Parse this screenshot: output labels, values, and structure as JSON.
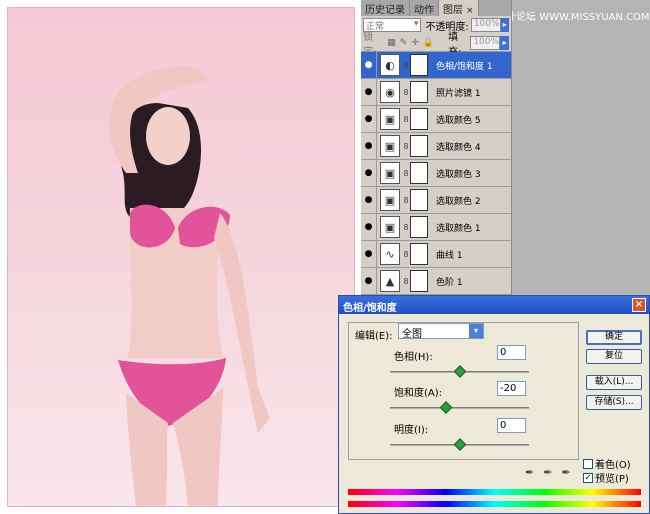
{
  "watermark": "思缘设计论坛 WWW.MISSYUAN.COM",
  "panel": {
    "tabs": [
      {
        "label": "历史记录",
        "active": false
      },
      {
        "label": "动作",
        "active": false
      },
      {
        "label": "图层",
        "active": true
      }
    ],
    "close": "×",
    "blend_mode": "正常",
    "opacity_label": "不透明度:",
    "opacity_value": "100%",
    "lock_label": "锁定:",
    "fill_label": "填充:",
    "fill_value": "100%",
    "layers": [
      {
        "name": "色相/饱和度 1",
        "selected": true,
        "thumb": "hue-icon"
      },
      {
        "name": "照片滤镜 1",
        "selected": false,
        "thumb": "filter-icon"
      },
      {
        "name": "选取颜色 5",
        "selected": false,
        "thumb": "selective-color-icon"
      },
      {
        "name": "选取颜色 4",
        "selected": false,
        "thumb": "selective-color-icon"
      },
      {
        "name": "选取颜色 3",
        "selected": false,
        "thumb": "selective-color-icon"
      },
      {
        "name": "选取颜色 2",
        "selected": false,
        "thumb": "selective-color-icon"
      },
      {
        "name": "选取颜色 1",
        "selected": false,
        "thumb": "selective-color-icon"
      },
      {
        "name": "曲线 1",
        "selected": false,
        "thumb": "curves-icon"
      },
      {
        "name": "色阶 1",
        "selected": false,
        "thumb": "levels-icon"
      }
    ]
  },
  "dialog": {
    "title": "色相/饱和度",
    "close": "×",
    "edit_label": "编辑(E):",
    "edit_value": "全图",
    "params": [
      {
        "label": "色相(H):",
        "value": "0"
      },
      {
        "label": "饱和度(A):",
        "value": "-20"
      },
      {
        "label": "明度(I):",
        "value": "0"
      }
    ],
    "buttons": {
      "ok": "确定",
      "reset": "复位",
      "load": "载入(L)...",
      "save": "存储(S)..."
    },
    "colorize_label": "着色(O)",
    "colorize_checked": false,
    "preview_label": "预览(P)",
    "preview_checked": true
  }
}
